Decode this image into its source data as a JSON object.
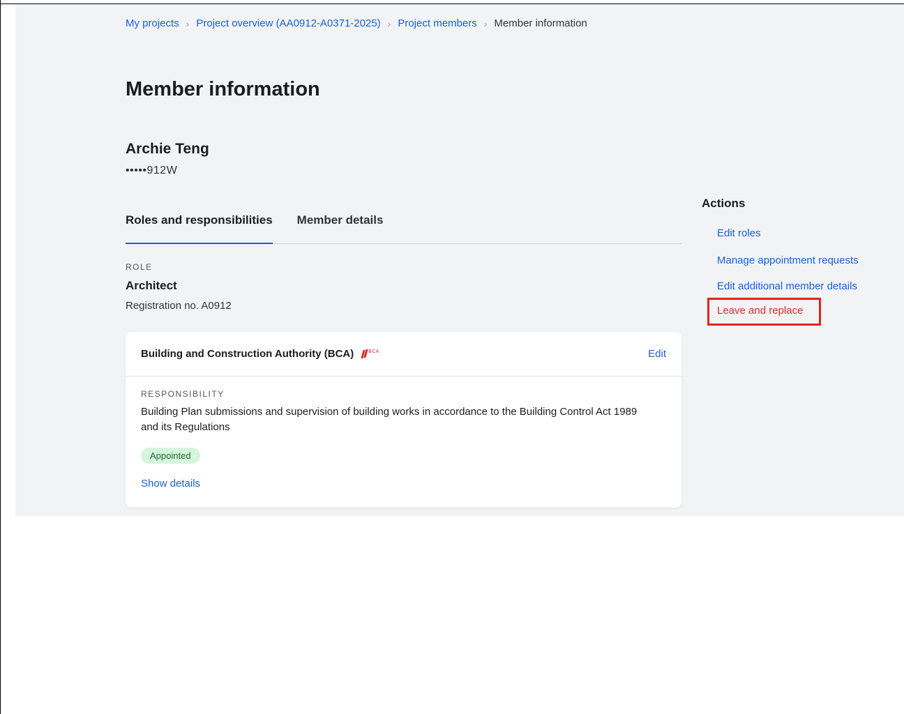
{
  "breadcrumb": {
    "items": [
      "My projects",
      "Project overview (AA0912-A0371-2025)",
      "Project members"
    ],
    "current": "Member information"
  },
  "page_title": "Member information",
  "member": {
    "name": "Archie Teng",
    "masked_id": "•••••912W"
  },
  "tabs": [
    "Roles and responsibilities",
    "Member details"
  ],
  "active_tab": "Roles and responsibilities",
  "role": {
    "label": "ROLE",
    "title": "Architect",
    "registration": "Registration no. A0912"
  },
  "card": {
    "agency": "Building and Construction Authority (BCA)",
    "logo_text": "BCA",
    "edit_label": "Edit",
    "responsibility_label": "RESPONSIBILITY",
    "responsibility_text": "Building Plan submissions and supervision of building works in accordance to the Building Control Act 1989 and its Regulations",
    "status": "Appointed",
    "show_details": "Show details"
  },
  "actions": {
    "title": "Actions",
    "items": [
      "Edit roles",
      "Manage appointment requests",
      "Edit additional member details",
      "Leave and replace"
    ]
  },
  "colors": {
    "link": "#1a5fd6",
    "danger": "#d92b2b",
    "highlight": "#e0221e",
    "badge_bg": "#d6f5dc",
    "page_bg": "#f1f3f5"
  }
}
